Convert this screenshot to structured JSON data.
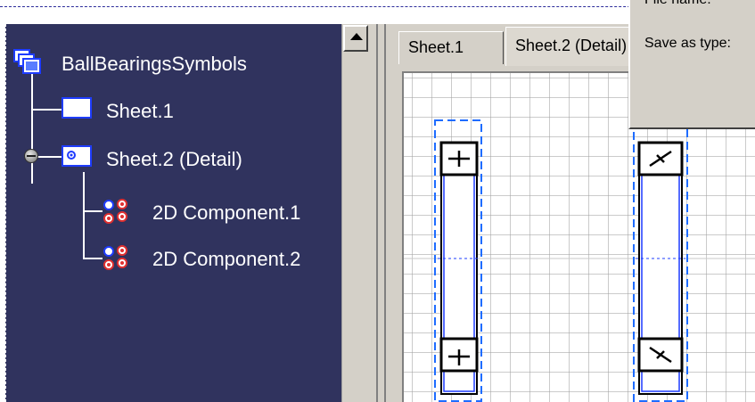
{
  "tree": {
    "root": {
      "label": "BallBearingsSymbols",
      "icon": "drawing-root-icon"
    },
    "items": [
      {
        "label": "Sheet.1",
        "icon": "sheet-icon"
      },
      {
        "label": "Sheet.2 (Detail)",
        "icon": "detail-sheet-icon"
      },
      {
        "label": "2D Component.1",
        "icon": "component-icon"
      },
      {
        "label": "2D Component.2",
        "icon": "component-icon"
      }
    ]
  },
  "tabs": [
    {
      "label": "Sheet.1"
    },
    {
      "label": "Sheet.2 (Detail)"
    }
  ],
  "dialog": {
    "file_name_label": "File name:",
    "save_as_type_label": "Save as type:"
  },
  "colors": {
    "tree_background": "#30335e",
    "accent_blue": "#2255ff",
    "component_red": "#e03030"
  }
}
